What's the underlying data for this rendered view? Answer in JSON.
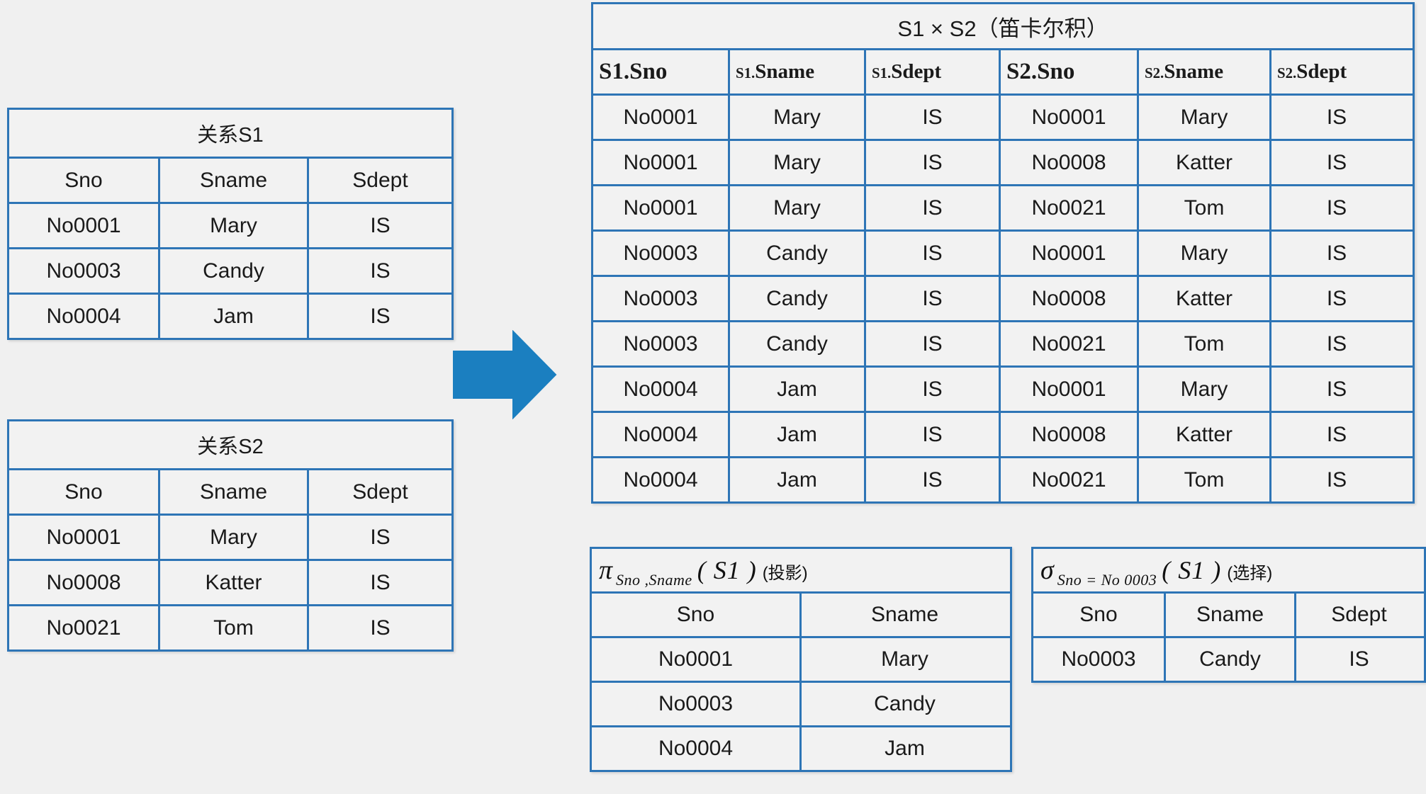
{
  "theme": {
    "background": "#f0f0f0",
    "border_color": "#2e75b6",
    "cell_background": "#f2f2f2",
    "arrow_color": "#1b7fc0",
    "text_color": "#1a1a1a"
  },
  "tables": {
    "s1": {
      "title": "关系S1",
      "columns": [
        "Sno",
        "Sname",
        "Sdept"
      ],
      "rows": [
        [
          "No0001",
          "Mary",
          "IS"
        ],
        [
          "No0003",
          "Candy",
          "IS"
        ],
        [
          "No0004",
          "Jam",
          "IS"
        ]
      ]
    },
    "s2": {
      "title": "关系S2",
      "columns": [
        "Sno",
        "Sname",
        "Sdept"
      ],
      "rows": [
        [
          "No0001",
          "Mary",
          "IS"
        ],
        [
          "No0008",
          "Katter",
          "IS"
        ],
        [
          "No0021",
          "Tom",
          "IS"
        ]
      ]
    },
    "cartesian": {
      "title": "S1 × S2（笛卡尔积）",
      "columns": [
        "S1.Sno",
        "S1.Sname",
        "S1.Sdept",
        "S2.Sno",
        "S2.Sname",
        "S2.Sdept"
      ],
      "column_parts": [
        {
          "prefix": "S1.",
          "name": "Sno",
          "prefix_small": false
        },
        {
          "prefix": "S1.",
          "name": "Sname",
          "prefix_small": true
        },
        {
          "prefix": "S1.",
          "name": "Sdept",
          "prefix_small": true
        },
        {
          "prefix": "S2.",
          "name": "Sno",
          "prefix_small": false
        },
        {
          "prefix": "S2.",
          "name": "Sname",
          "prefix_small": true
        },
        {
          "prefix": "S2.",
          "name": "Sdept",
          "prefix_small": true
        }
      ],
      "rows": [
        [
          "No0001",
          "Mary",
          "IS",
          "No0001",
          "Mary",
          "IS"
        ],
        [
          "No0001",
          "Mary",
          "IS",
          "No0008",
          "Katter",
          "IS"
        ],
        [
          "No0001",
          "Mary",
          "IS",
          "No0021",
          "Tom",
          "IS"
        ],
        [
          "No0003",
          "Candy",
          "IS",
          "No0001",
          "Mary",
          "IS"
        ],
        [
          "No0003",
          "Candy",
          "IS",
          "No0008",
          "Katter",
          "IS"
        ],
        [
          "No0003",
          "Candy",
          "IS",
          "No0021",
          "Tom",
          "IS"
        ],
        [
          "No0004",
          "Jam",
          "IS",
          "No0001",
          "Mary",
          "IS"
        ],
        [
          "No0004",
          "Jam",
          "IS",
          "No0008",
          "Katter",
          "IS"
        ],
        [
          "No0004",
          "Jam",
          "IS",
          "No0021",
          "Tom",
          "IS"
        ]
      ]
    },
    "projection": {
      "title_text": "π Sno,Sname (S1) (投影)",
      "operator": "π",
      "subscript": "Sno ,Sname",
      "argument": "( S1 )",
      "note": "(投影)",
      "columns": [
        "Sno",
        "Sname"
      ],
      "rows": [
        [
          "No0001",
          "Mary"
        ],
        [
          "No0003",
          "Candy"
        ],
        [
          "No0004",
          "Jam"
        ]
      ]
    },
    "selection": {
      "title_text": "σ Sno=No0003 (S1) (选择)",
      "operator": "σ",
      "subscript": "Sno = No 0003",
      "argument": "( S1 )",
      "note": "(选择)",
      "columns": [
        "Sno",
        "Sname",
        "Sdept"
      ],
      "rows": [
        [
          "No0003",
          "Candy",
          "IS"
        ]
      ]
    }
  },
  "arrow": {
    "label": "flow-arrow-right",
    "direction": "right"
  }
}
